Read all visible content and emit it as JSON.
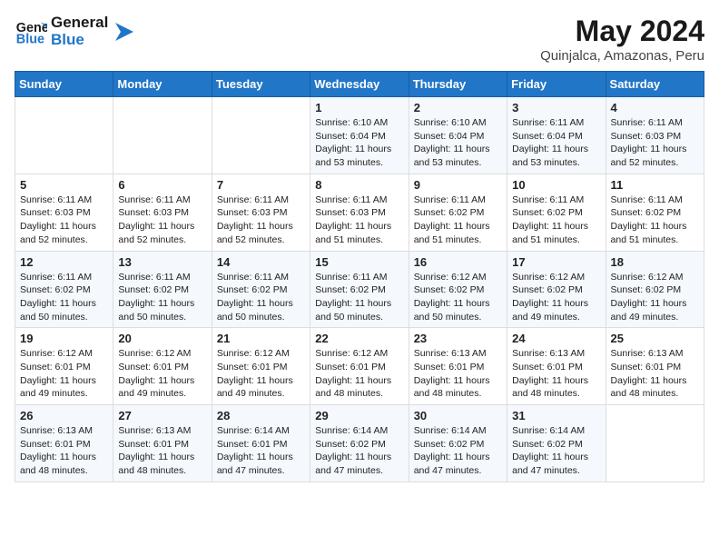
{
  "header": {
    "logo_line1": "General",
    "logo_line2": "Blue",
    "month": "May 2024",
    "location": "Quinjalca, Amazonas, Peru"
  },
  "weekdays": [
    "Sunday",
    "Monday",
    "Tuesday",
    "Wednesday",
    "Thursday",
    "Friday",
    "Saturday"
  ],
  "weeks": [
    [
      {
        "day": "",
        "info": ""
      },
      {
        "day": "",
        "info": ""
      },
      {
        "day": "",
        "info": ""
      },
      {
        "day": "1",
        "info": "Sunrise: 6:10 AM\nSunset: 6:04 PM\nDaylight: 11 hours and 53 minutes."
      },
      {
        "day": "2",
        "info": "Sunrise: 6:10 AM\nSunset: 6:04 PM\nDaylight: 11 hours and 53 minutes."
      },
      {
        "day": "3",
        "info": "Sunrise: 6:11 AM\nSunset: 6:04 PM\nDaylight: 11 hours and 53 minutes."
      },
      {
        "day": "4",
        "info": "Sunrise: 6:11 AM\nSunset: 6:03 PM\nDaylight: 11 hours and 52 minutes."
      }
    ],
    [
      {
        "day": "5",
        "info": "Sunrise: 6:11 AM\nSunset: 6:03 PM\nDaylight: 11 hours and 52 minutes."
      },
      {
        "day": "6",
        "info": "Sunrise: 6:11 AM\nSunset: 6:03 PM\nDaylight: 11 hours and 52 minutes."
      },
      {
        "day": "7",
        "info": "Sunrise: 6:11 AM\nSunset: 6:03 PM\nDaylight: 11 hours and 52 minutes."
      },
      {
        "day": "8",
        "info": "Sunrise: 6:11 AM\nSunset: 6:03 PM\nDaylight: 11 hours and 51 minutes."
      },
      {
        "day": "9",
        "info": "Sunrise: 6:11 AM\nSunset: 6:02 PM\nDaylight: 11 hours and 51 minutes."
      },
      {
        "day": "10",
        "info": "Sunrise: 6:11 AM\nSunset: 6:02 PM\nDaylight: 11 hours and 51 minutes."
      },
      {
        "day": "11",
        "info": "Sunrise: 6:11 AM\nSunset: 6:02 PM\nDaylight: 11 hours and 51 minutes."
      }
    ],
    [
      {
        "day": "12",
        "info": "Sunrise: 6:11 AM\nSunset: 6:02 PM\nDaylight: 11 hours and 50 minutes."
      },
      {
        "day": "13",
        "info": "Sunrise: 6:11 AM\nSunset: 6:02 PM\nDaylight: 11 hours and 50 minutes."
      },
      {
        "day": "14",
        "info": "Sunrise: 6:11 AM\nSunset: 6:02 PM\nDaylight: 11 hours and 50 minutes."
      },
      {
        "day": "15",
        "info": "Sunrise: 6:11 AM\nSunset: 6:02 PM\nDaylight: 11 hours and 50 minutes."
      },
      {
        "day": "16",
        "info": "Sunrise: 6:12 AM\nSunset: 6:02 PM\nDaylight: 11 hours and 50 minutes."
      },
      {
        "day": "17",
        "info": "Sunrise: 6:12 AM\nSunset: 6:02 PM\nDaylight: 11 hours and 49 minutes."
      },
      {
        "day": "18",
        "info": "Sunrise: 6:12 AM\nSunset: 6:02 PM\nDaylight: 11 hours and 49 minutes."
      }
    ],
    [
      {
        "day": "19",
        "info": "Sunrise: 6:12 AM\nSunset: 6:01 PM\nDaylight: 11 hours and 49 minutes."
      },
      {
        "day": "20",
        "info": "Sunrise: 6:12 AM\nSunset: 6:01 PM\nDaylight: 11 hours and 49 minutes."
      },
      {
        "day": "21",
        "info": "Sunrise: 6:12 AM\nSunset: 6:01 PM\nDaylight: 11 hours and 49 minutes."
      },
      {
        "day": "22",
        "info": "Sunrise: 6:12 AM\nSunset: 6:01 PM\nDaylight: 11 hours and 48 minutes."
      },
      {
        "day": "23",
        "info": "Sunrise: 6:13 AM\nSunset: 6:01 PM\nDaylight: 11 hours and 48 minutes."
      },
      {
        "day": "24",
        "info": "Sunrise: 6:13 AM\nSunset: 6:01 PM\nDaylight: 11 hours and 48 minutes."
      },
      {
        "day": "25",
        "info": "Sunrise: 6:13 AM\nSunset: 6:01 PM\nDaylight: 11 hours and 48 minutes."
      }
    ],
    [
      {
        "day": "26",
        "info": "Sunrise: 6:13 AM\nSunset: 6:01 PM\nDaylight: 11 hours and 48 minutes."
      },
      {
        "day": "27",
        "info": "Sunrise: 6:13 AM\nSunset: 6:01 PM\nDaylight: 11 hours and 48 minutes."
      },
      {
        "day": "28",
        "info": "Sunrise: 6:14 AM\nSunset: 6:01 PM\nDaylight: 11 hours and 47 minutes."
      },
      {
        "day": "29",
        "info": "Sunrise: 6:14 AM\nSunset: 6:02 PM\nDaylight: 11 hours and 47 minutes."
      },
      {
        "day": "30",
        "info": "Sunrise: 6:14 AM\nSunset: 6:02 PM\nDaylight: 11 hours and 47 minutes."
      },
      {
        "day": "31",
        "info": "Sunrise: 6:14 AM\nSunset: 6:02 PM\nDaylight: 11 hours and 47 minutes."
      },
      {
        "day": "",
        "info": ""
      }
    ]
  ]
}
